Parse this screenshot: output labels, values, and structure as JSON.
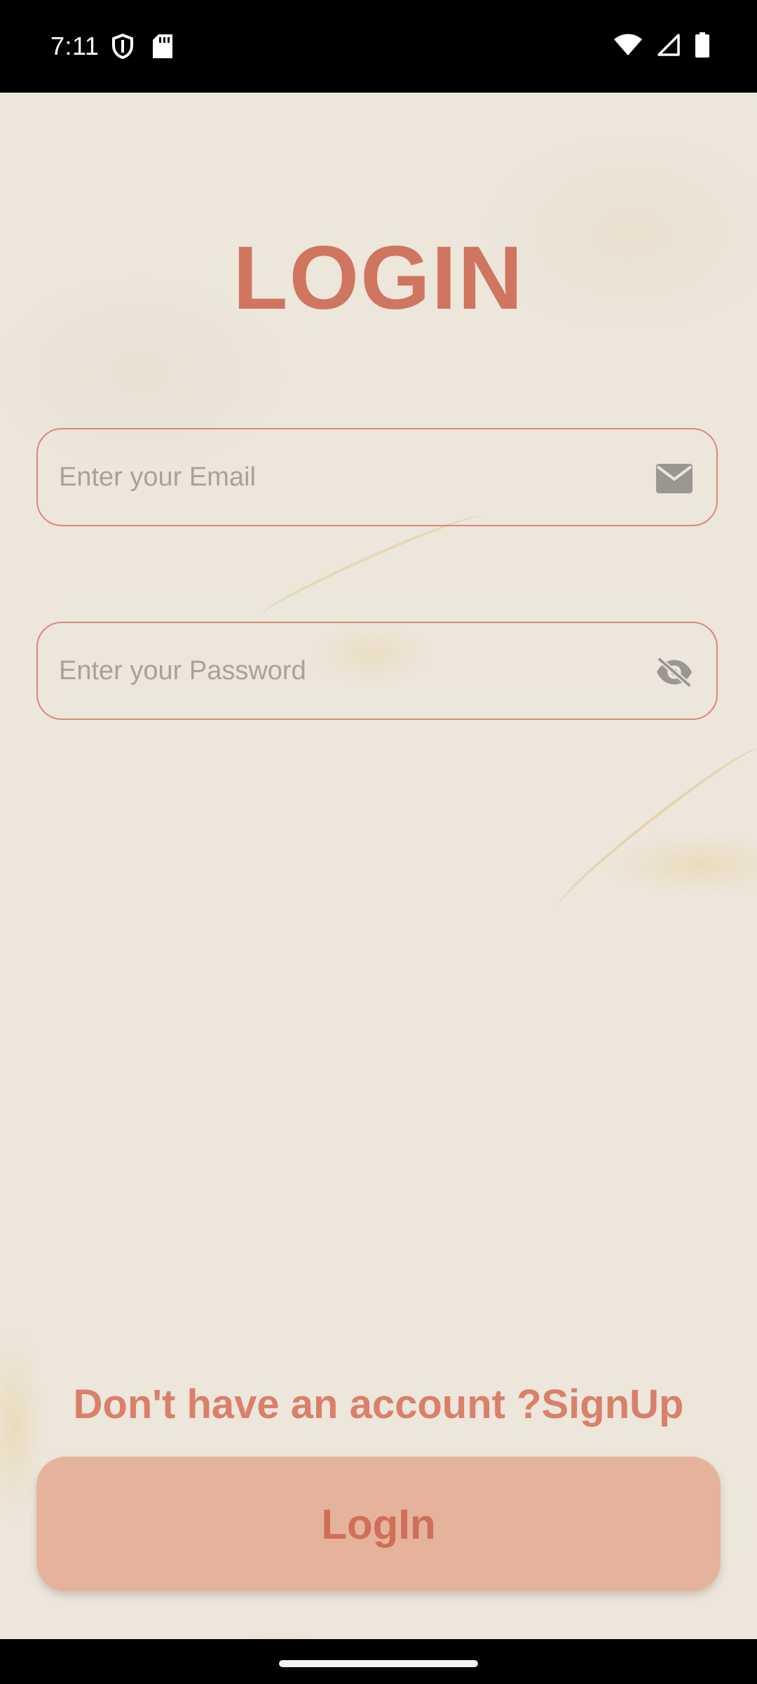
{
  "status_bar": {
    "time": "7:11",
    "left_icons": [
      "shield-icon",
      "sd-card-icon"
    ],
    "right_icons": [
      "wifi-icon",
      "cell-signal-icon",
      "battery-icon"
    ]
  },
  "login_screen": {
    "title": "LOGIN",
    "email_field": {
      "placeholder": "Enter your Email",
      "value": "",
      "icon": "mail-icon"
    },
    "password_field": {
      "placeholder": "Enter your Password",
      "value": "",
      "icon": "visibility-off-icon"
    },
    "signup_prompt": "Don't have an account ?",
    "signup_link": "SignUp",
    "login_button": "LogIn"
  },
  "colors": {
    "accent": "#cf7560",
    "button_bg": "#e5b39c",
    "field_border": "#d9897a",
    "paper_bg": "#ece6db"
  }
}
